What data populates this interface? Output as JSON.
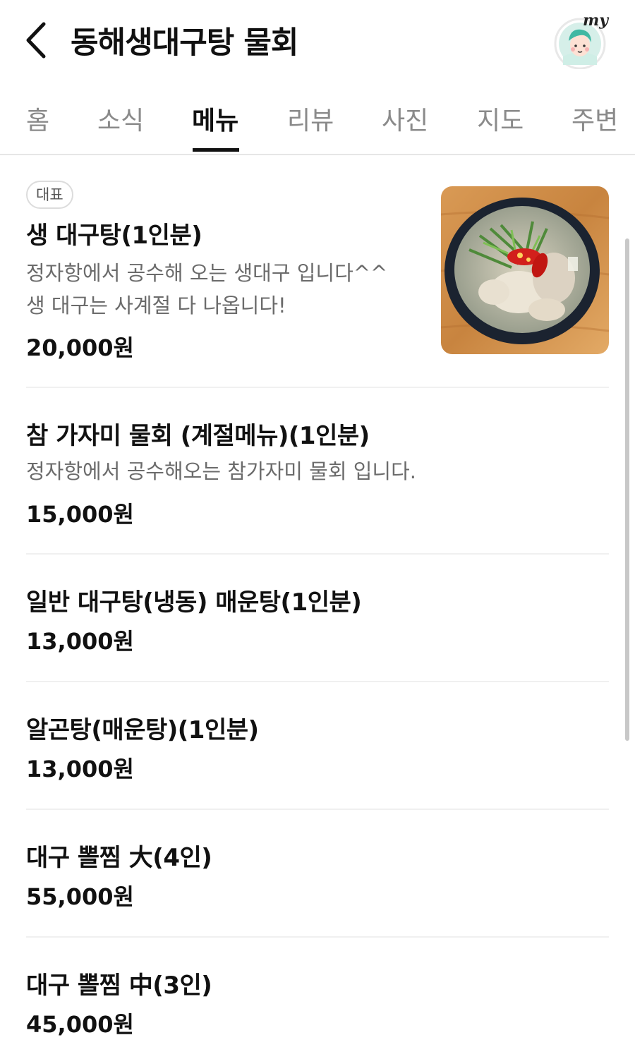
{
  "header": {
    "title": "동해생대구탕 물회",
    "my_label": "my"
  },
  "tabs": [
    {
      "label": "홈",
      "active": false
    },
    {
      "label": "소식",
      "active": false
    },
    {
      "label": "메뉴",
      "active": true
    },
    {
      "label": "리뷰",
      "active": false
    },
    {
      "label": "사진",
      "active": false
    },
    {
      "label": "지도",
      "active": false
    },
    {
      "label": "주변",
      "active": false
    }
  ],
  "menu": {
    "items": [
      {
        "badge": "대표",
        "name": "생 대구탕(1인분)",
        "desc1": "정자항에서 공수해 오는 생대구 입니다^^",
        "desc2": "생 대구는 사계절 다 나옵니다!",
        "price": "20,000원",
        "image": "cod-soup-photo"
      },
      {
        "name": "참 가자미 물회 (계절메뉴)(1인분)",
        "desc1": "정자항에서 공수해오는 참가자미 물회 입니다.",
        "price": "15,000원"
      },
      {
        "name": "일반 대구탕(냉동) 매운탕(1인분)",
        "price": "13,000원"
      },
      {
        "name": "알곤탕(매운탕)(1인분)",
        "price": "13,000원"
      },
      {
        "name": "대구 뽈찜 大(4인)",
        "price": "55,000원"
      },
      {
        "name": "대구 뽈찜 中(3인)",
        "price": "45,000원"
      }
    ]
  },
  "colors": {
    "text_primary": "#111111",
    "text_secondary": "#6b6b6b",
    "tab_inactive": "#8a8a8a",
    "divider": "#f0f0f0"
  }
}
